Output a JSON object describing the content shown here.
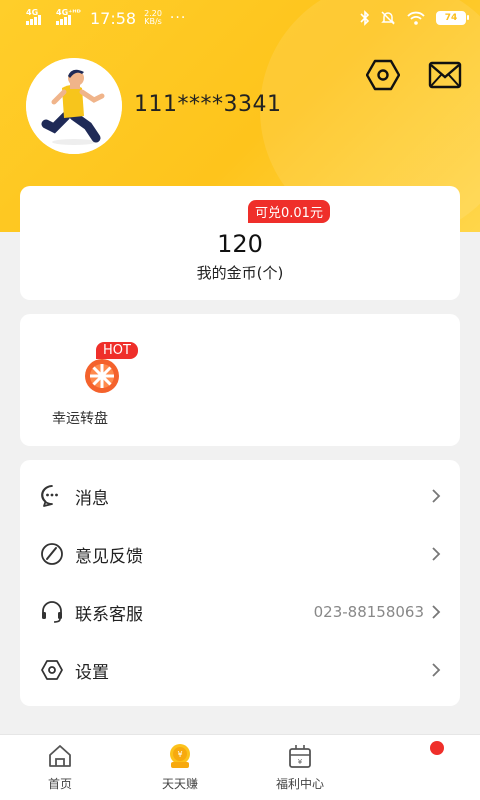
{
  "status_bar": {
    "net1": "4G",
    "net2": "4G⁺ᴴᴰ",
    "time": "17:58",
    "speed_value": "2.20",
    "speed_unit": "KB/s",
    "dots": "···",
    "battery": "74"
  },
  "profile": {
    "phone": "111****3341"
  },
  "coins": {
    "exchange_tag": "可兑0.01元",
    "value": "120",
    "label": "我的金币(个)"
  },
  "features": [
    {
      "label": "幸运转盘",
      "tag": "HOT",
      "icon": "lucky-wheel-icon"
    }
  ],
  "menu": [
    {
      "label": "消息",
      "value": "",
      "icon": "message-icon"
    },
    {
      "label": "意见反馈",
      "value": "",
      "icon": "feedback-icon"
    },
    {
      "label": "联系客服",
      "value": "023-88158063",
      "icon": "headset-icon"
    },
    {
      "label": "设置",
      "value": "",
      "icon": "settings-icon"
    }
  ],
  "bottom_nav": [
    {
      "label": "首页",
      "icon": "home-icon"
    },
    {
      "label": "天天赚",
      "icon": "coin-icon"
    },
    {
      "label": "福利中心",
      "icon": "gift-box-icon"
    },
    {
      "label": "",
      "icon": "profile-icon"
    }
  ],
  "colors": {
    "header_yellow": "#fec41c",
    "badge_red": "#ef2f2a",
    "text_dark": "#222222",
    "text_gray": "#888888"
  }
}
